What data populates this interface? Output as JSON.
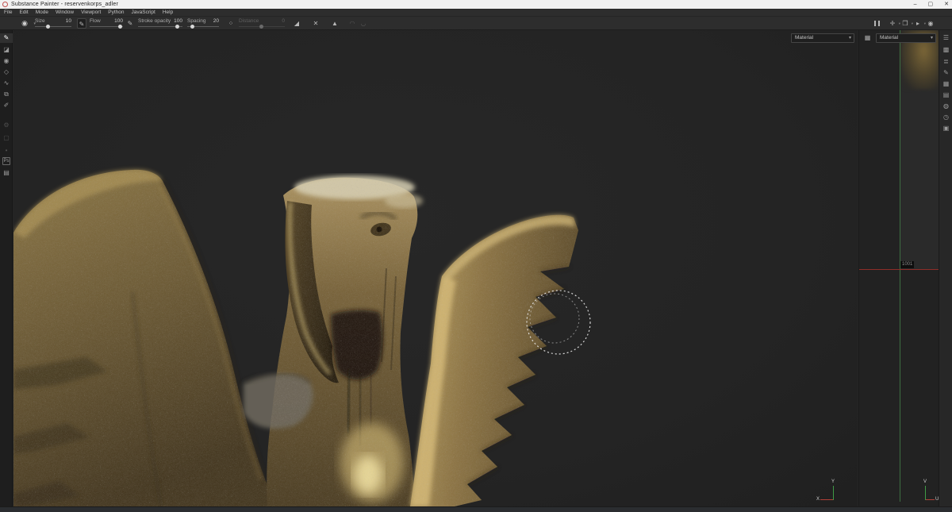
{
  "window": {
    "title": "Substance Painter - reservenkorps_adler",
    "minimize": "–",
    "maximize": "▢",
    "close": "✕"
  },
  "menu": {
    "items": [
      "File",
      "Edit",
      "Mode",
      "Window",
      "Viewport",
      "Python",
      "JavaScript",
      "Help"
    ]
  },
  "toolbar": {
    "brush_preview_glyph": "◉",
    "dropdown_chevron": "▾",
    "size": {
      "label": "Size",
      "value": "10"
    },
    "flow": {
      "label": "Flow",
      "value": "100"
    },
    "stroke_opacity": {
      "label": "Stroke opacity",
      "value": "100"
    },
    "spacing": {
      "label": "Spacing",
      "value": "20"
    },
    "distance": {
      "label": "Distance",
      "value": "0"
    },
    "pen_toggle_glyph": "✎",
    "align_dots_glyph": "⁘",
    "lazy_mouse_glyph": "◢",
    "symmetry_x_glyph": "✕",
    "mirror_glyph": "▲",
    "rotation_a_glyph": "◠",
    "rotation_b_glyph": "◡"
  },
  "mini_toolbar": {
    "move_glyph": "✛",
    "perspective_glyph": "❒",
    "camera_glyph": "▸",
    "snapshot_glyph": "◉",
    "chevron": "▾"
  },
  "left_strip": {
    "items": [
      {
        "glyph": "✎"
      },
      {
        "glyph": "◪"
      },
      {
        "glyph": "◉"
      },
      {
        "glyph": "◇"
      },
      {
        "glyph": "∿"
      },
      {
        "glyph": "⧉"
      },
      {
        "glyph": "✐"
      },
      {
        "glyph": "⚙"
      },
      {
        "glyph": "▢"
      },
      {
        "glyph": "•"
      },
      {
        "glyph": "Ps"
      },
      {
        "glyph": "▤"
      }
    ]
  },
  "right_strip": {
    "items": [
      {
        "glyph": "☰"
      },
      {
        "glyph": "▩"
      },
      {
        "glyph": "≣"
      },
      {
        "glyph": "✎"
      },
      {
        "glyph": "▦"
      },
      {
        "glyph": "▤"
      },
      {
        "glyph": "◍"
      },
      {
        "glyph": "◷"
      },
      {
        "glyph": "▣"
      }
    ]
  },
  "viewport_3d": {
    "shading_mode": "Material",
    "gizmo": {
      "x": "X",
      "y": "Y"
    }
  },
  "view_2d": {
    "header_icon_glyph": "▦",
    "channel_mode": "Material",
    "udim_label": "1001",
    "gizmo": {
      "u": "U",
      "v": "V"
    }
  },
  "colors": {
    "axis_green": "#3d6e42",
    "axis_red": "#8e2d28",
    "statue_gold_light": "#d6c08a",
    "statue_gold_mid": "#8a7345",
    "statue_gold_dark": "#4a3c22",
    "viewport_bg": "#252525"
  }
}
